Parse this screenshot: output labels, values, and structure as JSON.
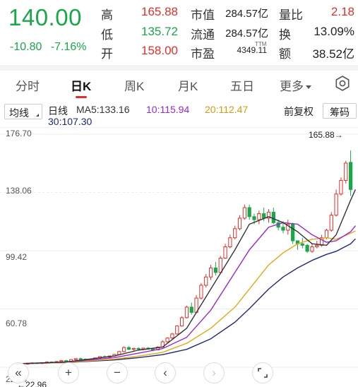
{
  "quote": {
    "price": "140.00",
    "change": "-10.80",
    "change_pct": "-7.16%",
    "high_label": "高",
    "high": "165.88",
    "low_label": "低",
    "low": "135.72",
    "open_label": "开",
    "open": "158.00",
    "mktcap_label": "市值",
    "mktcap": "284.57亿",
    "float_label": "流通",
    "float": "284.57亿",
    "pe_label": "市盈",
    "pe_sup": "TTM",
    "pe": "4349.11",
    "volratio_label": "量比",
    "volratio": "2.18",
    "turnover_label": "换",
    "turnover": "13.09%",
    "amount_label": "额",
    "amount": "38.52亿"
  },
  "tabs": [
    {
      "label": "分时"
    },
    {
      "label": "日K"
    },
    {
      "label": "周K"
    },
    {
      "label": "月K"
    },
    {
      "label": "五日"
    },
    {
      "label": "更多"
    }
  ],
  "indicator": {
    "select_label": "均线",
    "kind": "日线",
    "ma5": "MA5:133.16",
    "ma10": "10:115.94",
    "ma20": "20:112.47",
    "ma30": "30:107.30",
    "adjust": "前复权",
    "chip": "筹码"
  },
  "colors": {
    "up": "#e0302b",
    "down": "#1aa64a",
    "ma5": "#333333",
    "ma10": "#9b27c9",
    "ma20": "#e6a817",
    "ma30": "#1b2a7a"
  },
  "chart_data": {
    "type": "candlestick",
    "y_ticks": [
      "176.70",
      "138.06",
      "99.42",
      "60.78",
      "22.14"
    ],
    "ylim": [
      22.14,
      176.7
    ],
    "max_label": "165.88→",
    "min_label": "←22.96",
    "candles": [
      [
        24,
        25,
        23.5,
        24.5
      ],
      [
        24.5,
        25,
        23.8,
        24.2
      ],
      [
        24.2,
        25,
        23.8,
        24.8
      ],
      [
        24.8,
        25.5,
        24.3,
        25
      ],
      [
        25,
        25.3,
        24.4,
        24.6
      ],
      [
        24.6,
        25.5,
        24.3,
        25.2
      ],
      [
        25.2,
        26,
        24.8,
        25.6
      ],
      [
        25.6,
        26,
        25,
        25.3
      ],
      [
        25.3,
        26.2,
        25,
        25.9
      ],
      [
        25.9,
        27,
        25.5,
        26.5
      ],
      [
        26.5,
        27,
        25.9,
        26.1
      ],
      [
        26.1,
        27.5,
        25.8,
        27.2
      ],
      [
        27.2,
        28,
        26.6,
        27.8
      ],
      [
        27.8,
        28.5,
        27.2,
        27.5
      ],
      [
        27.5,
        28,
        26.5,
        26.8
      ],
      [
        26.8,
        27.5,
        26.2,
        27.1
      ],
      [
        27.1,
        28.5,
        26.9,
        28.3
      ],
      [
        28.3,
        29.5,
        28,
        29.2
      ],
      [
        29.2,
        30,
        28.5,
        28.8
      ],
      [
        28.8,
        29.8,
        28.4,
        29.6
      ],
      [
        29.6,
        31,
        29.2,
        30.6
      ],
      [
        30.6,
        33,
        30.3,
        32.5
      ],
      [
        32.5,
        36,
        32,
        35.2
      ],
      [
        35.2,
        36,
        33.5,
        34
      ],
      [
        34,
        35,
        33,
        34.6
      ],
      [
        34.6,
        35.4,
        33.6,
        34.1
      ],
      [
        34.1,
        35.2,
        33.3,
        34.8
      ],
      [
        34.8,
        35.5,
        33.8,
        34.2
      ],
      [
        34.2,
        35,
        32.8,
        33.6
      ],
      [
        33.6,
        36,
        33.4,
        35.5
      ],
      [
        35.5,
        40,
        35.2,
        39
      ],
      [
        39,
        42,
        38.5,
        41.5
      ],
      [
        41.5,
        45,
        41,
        44.2
      ],
      [
        44.2,
        50,
        43.8,
        49.5
      ],
      [
        49.5,
        56,
        49,
        55
      ],
      [
        55,
        63,
        54.5,
        62
      ],
      [
        62,
        65,
        57,
        58.5
      ],
      [
        58.5,
        70,
        58,
        68
      ],
      [
        68,
        78,
        67,
        76.5
      ],
      [
        76.5,
        84,
        75,
        82
      ],
      [
        82,
        90,
        80,
        88
      ],
      [
        88,
        92,
        83,
        85
      ],
      [
        85,
        96,
        84,
        94.5
      ],
      [
        94.5,
        104,
        94,
        102
      ],
      [
        102,
        110,
        101,
        108
      ],
      [
        108,
        116,
        107,
        114
      ],
      [
        114,
        123,
        113,
        121
      ],
      [
        121,
        130,
        120,
        128
      ],
      [
        128,
        130,
        120,
        122
      ],
      [
        122,
        124,
        117,
        120
      ],
      [
        120,
        126,
        117,
        124
      ],
      [
        124,
        128,
        119,
        121
      ],
      [
        121,
        127,
        118,
        125
      ],
      [
        125,
        128,
        117,
        118
      ],
      [
        118,
        120,
        113,
        115
      ],
      [
        115,
        119,
        111,
        113
      ],
      [
        113,
        120,
        110,
        117
      ],
      [
        117,
        118,
        104,
        106
      ],
      [
        106,
        106,
        100,
        104
      ],
      [
        104,
        108,
        101,
        103
      ],
      [
        103,
        104,
        98,
        99
      ],
      [
        99,
        104,
        98,
        102
      ],
      [
        102,
        106,
        101,
        103
      ],
      [
        103,
        110,
        102,
        108
      ],
      [
        108,
        114,
        107,
        113
      ],
      [
        113,
        125,
        112,
        123
      ],
      [
        123,
        140,
        122,
        137
      ],
      [
        137,
        148,
        136,
        146
      ],
      [
        146,
        159,
        144,
        157.5
      ],
      [
        158,
        165.88,
        135.72,
        140
      ]
    ],
    "ma5": [
      [
        0,
        24.4
      ],
      [
        10,
        25.6
      ],
      [
        20,
        29.6
      ],
      [
        25,
        33.5
      ],
      [
        30,
        35.5
      ],
      [
        35,
        48
      ],
      [
        40,
        74
      ],
      [
        45,
        100
      ],
      [
        48,
        117
      ],
      [
        52,
        122
      ],
      [
        55,
        118
      ],
      [
        58,
        112
      ],
      [
        61,
        104
      ],
      [
        64,
        103
      ],
      [
        66,
        110
      ],
      [
        69,
        133
      ],
      [
        70,
        140
      ]
    ],
    "ma10": [
      [
        0,
        24.5
      ],
      [
        10,
        25.5
      ],
      [
        20,
        28.5
      ],
      [
        25,
        31.5
      ],
      [
        30,
        34.5
      ],
      [
        35,
        42
      ],
      [
        40,
        60
      ],
      [
        45,
        85
      ],
      [
        48,
        100
      ],
      [
        52,
        115
      ],
      [
        55,
        118
      ],
      [
        58,
        117
      ],
      [
        61,
        110
      ],
      [
        64,
        105
      ],
      [
        66,
        106
      ],
      [
        69,
        112
      ],
      [
        70,
        116
      ]
    ],
    "ma20": [
      [
        0,
        24.5
      ],
      [
        10,
        25.3
      ],
      [
        20,
        27.5
      ],
      [
        25,
        29.5
      ],
      [
        30,
        32
      ],
      [
        35,
        38
      ],
      [
        40,
        48
      ],
      [
        45,
        62
      ],
      [
        48,
        74
      ],
      [
        52,
        90
      ],
      [
        55,
        98
      ],
      [
        58,
        104
      ],
      [
        61,
        107
      ],
      [
        64,
        108
      ],
      [
        66,
        107
      ],
      [
        69,
        111
      ],
      [
        70,
        112.5
      ]
    ],
    "ma30": [
      [
        0,
        24.5
      ],
      [
        10,
        25.2
      ],
      [
        20,
        27
      ],
      [
        25,
        28.5
      ],
      [
        30,
        30.5
      ],
      [
        35,
        34
      ],
      [
        40,
        41
      ],
      [
        45,
        52
      ],
      [
        48,
        61
      ],
      [
        52,
        74
      ],
      [
        55,
        82
      ],
      [
        58,
        88
      ],
      [
        61,
        93
      ],
      [
        64,
        97
      ],
      [
        66,
        99
      ],
      [
        69,
        104
      ],
      [
        70,
        107.3
      ]
    ]
  }
}
